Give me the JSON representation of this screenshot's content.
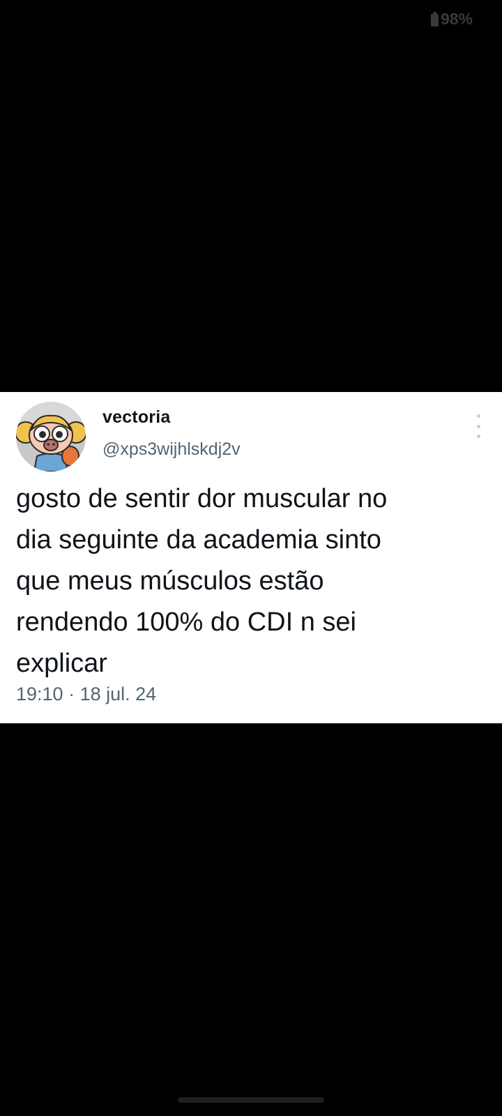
{
  "status_bar": {
    "battery_percent": "98%"
  },
  "tweet": {
    "display_name": "vectoria",
    "handle": "@xps3wijhlskdj2v",
    "text": "gosto de sentir dor muscular no\ndia seguinte da academia sinto\nque meus músculos estão\nrendendo 100% do CDI n sei\nexplicar",
    "time": "19:10",
    "separator": "·",
    "date": "18 jul. 24",
    "avatar_icon": "cartoon-girl-avatar",
    "more_icon": "more-vertical-icon"
  },
  "colors": {
    "background": "#000000",
    "card": "#ffffff",
    "primary_text": "#0f1419",
    "secondary_text": "#536471"
  }
}
